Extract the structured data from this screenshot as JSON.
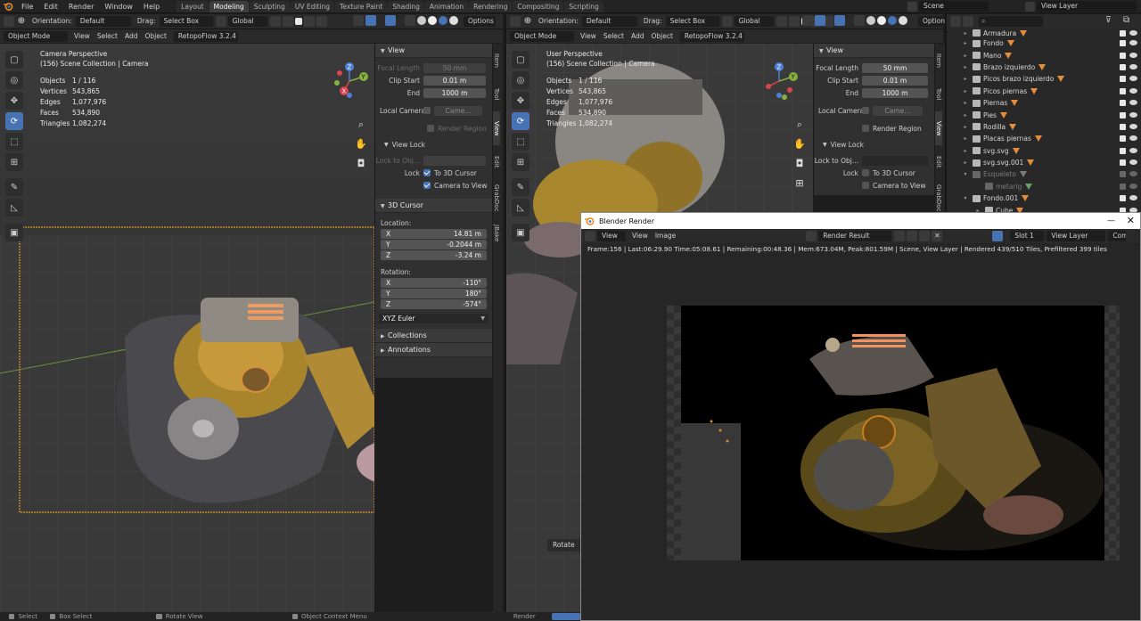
{
  "menu": [
    "File",
    "Edit",
    "Render",
    "Window",
    "Help"
  ],
  "workspaces": [
    "Layout",
    "Modeling",
    "Sculpting",
    "UV Editing",
    "Texture Paint",
    "Shading",
    "Animation",
    "Rendering",
    "Compositing",
    "Scripting"
  ],
  "active_workspace": "Modeling",
  "scene": "Scene",
  "view_layer": "View Layer",
  "header": {
    "orientation_label": "Orientation:",
    "orientation_value": "Default",
    "drag_label": "Drag:",
    "drag_value": "Select Box",
    "global": "Global",
    "options": "Options",
    "options_cut": "Option"
  },
  "view_header": {
    "mode": "Object Mode",
    "view": "View",
    "select": "Select",
    "add": "Add",
    "object": "Object",
    "addon": "RetopoFlow 3.2.4"
  },
  "left_viewport": {
    "line1": "Camera Perspective",
    "line2": "(156) Scene Collection | Camera",
    "stats": [
      {
        "k": "Objects",
        "v": "1 / 116"
      },
      {
        "k": "Vertices",
        "v": "543,865"
      },
      {
        "k": "Edges",
        "v": "1,077,976"
      },
      {
        "k": "Faces",
        "v": "534,890"
      },
      {
        "k": "Triangles",
        "v": "1,082,274"
      }
    ]
  },
  "right_viewport": {
    "line1": "User Perspective",
    "line2": "(156) Scene Collection | Camera",
    "stats": [
      {
        "k": "Objects",
        "v": "1 / 116"
      },
      {
        "k": "Vertices",
        "v": "543,865"
      },
      {
        "k": "Edges",
        "v": "1,077,976"
      },
      {
        "k": "Faces",
        "v": "534,890"
      },
      {
        "k": "Triangles",
        "v": "1,082,274"
      }
    ],
    "rotate_label": "Rotate"
  },
  "axis": {
    "x": "X",
    "y": "Y",
    "z": "Z"
  },
  "npanel": {
    "view_title": "View",
    "focal_length_label": "Focal Length",
    "focal_length": "50 mm",
    "clip_start_label": "Clip Start",
    "clip_start": "0.01 m",
    "end_label": "End",
    "end": "1000 m",
    "local_camera_label": "Local Camera",
    "local_camera_value": "Came...",
    "render_region": "Render Region",
    "view_lock_title": "View Lock",
    "lock_to_obj": "Lock to Obj...",
    "lock_label": "Lock",
    "to_3d_cursor": "To 3D Cursor",
    "camera_to_view": "Camera to View",
    "cursor_title": "3D Cursor",
    "location_label": "Location:",
    "loc_x": "14.81 m",
    "loc_y": "-0.2044 m",
    "loc_z": "-3.24 m",
    "rotation_label": "Rotation:",
    "rot_x": "-110°",
    "rot_y": "180°",
    "rot_z": "-574°",
    "euler": "XYZ Euler",
    "collections": "Collections",
    "annotations": "Annotations"
  },
  "side_tabs": [
    "Item",
    "Tool",
    "View",
    "Edit",
    "GrabDoc",
    "JBake"
  ],
  "outliner": [
    {
      "name": "Armadura",
      "exp": "▸",
      "color": "#e58c3a"
    },
    {
      "name": "Fondo",
      "exp": "▸",
      "color": "#e58c3a"
    },
    {
      "name": "Mano",
      "exp": "▸",
      "color": "#e58c3a"
    },
    {
      "name": "Brazo izquierdo",
      "exp": "▸",
      "color": "#e58c3a"
    },
    {
      "name": "Picos brazo izquierdo",
      "exp": "▸",
      "color": "#e58c3a"
    },
    {
      "name": "Picos piernas",
      "exp": "▸",
      "color": "#e58c3a"
    },
    {
      "name": "Piernas",
      "exp": "▸",
      "color": "#e58c3a"
    },
    {
      "name": "Pies",
      "exp": "▸",
      "color": "#e58c3a"
    },
    {
      "name": "Rodilla",
      "exp": "▸",
      "color": "#e58c3a"
    },
    {
      "name": "Placas piernas",
      "exp": "▸",
      "color": "#e58c3a"
    },
    {
      "name": "svg.svg",
      "exp": "▸",
      "color": "#e58c3a"
    },
    {
      "name": "svg.svg.001",
      "exp": "▸",
      "color": "#e58c3a"
    },
    {
      "name": "Esqueleto",
      "exp": "▾",
      "color": "#7a7a7a",
      "dim": true
    },
    {
      "name": "metarig",
      "exp": "",
      "color": "#6aa06a",
      "dim": true,
      "indent": true
    },
    {
      "name": "Fondo.001",
      "exp": "▾",
      "color": "#e58c3a"
    },
    {
      "name": "Cube",
      "exp": "▸",
      "color": "#e58c3a",
      "indent": true
    }
  ],
  "render": {
    "title": "Blender Render",
    "view": "View",
    "view2": "View",
    "image": "Image",
    "result": "Render Result",
    "slot": "Slot 1",
    "layer": "View Layer",
    "combined": "Comb",
    "status": "Frame:156 | Last:06:29.90 Time:05:08.61 | Remaining:00:48.36 | Mem:673.04M, Peak:801.59M | Scene, View Layer | Rendered 439/510 Tiles, Prefiltered 399 tiles"
  },
  "statusbar": {
    "select": "Select",
    "box": "Box Select",
    "rotate": "Rotate View",
    "context": "Object Context Menu",
    "render": "Render"
  }
}
